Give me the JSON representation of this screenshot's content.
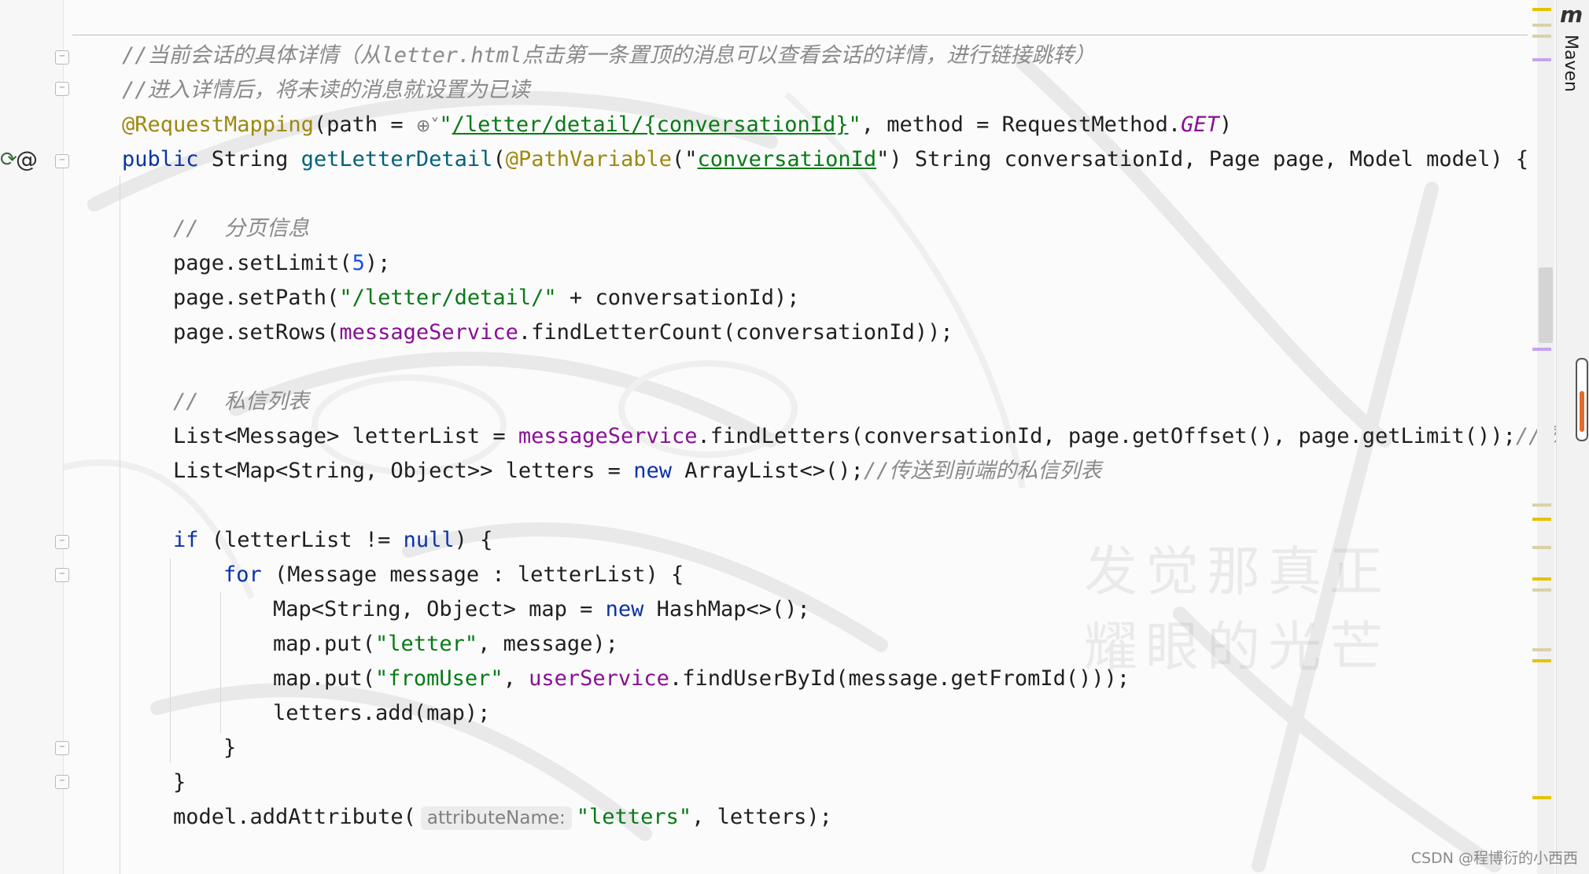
{
  "code": {
    "line1_comment": "//当前会话的具体详情（从letter.html点击第一条置顶的消息可以查看会话的详情，进行链接跳转）",
    "line2_comment": "//进入详情后，将未读的消息就设置为已读",
    "line3": {
      "annotation": "@RequestMapping",
      "open": "(path = ",
      "quote_open": "\"",
      "path": "/letter/detail/{conversationId}",
      "quote_close": "\"",
      "middle": ", method = RequestMethod.",
      "method_const": "GET",
      "close": ")"
    },
    "line4": {
      "kw_public": "public",
      "type": " String ",
      "method_name": "getLetterDetail",
      "paren": "(",
      "annotation": "@PathVariable",
      "ann_open": "(\"",
      "ann_value": "conversationId",
      "ann_close": "\")",
      "params": " String conversationId, Page page, Model model) {"
    },
    "line5_comment": "//  分页信息",
    "line6": {
      "pre": "page.setLimit(",
      "num": "5",
      "post": ");"
    },
    "line7": {
      "pre": "page.setPath(",
      "str": "\"/letter/detail/\"",
      "post": " + conversationId);"
    },
    "line8": {
      "pre": "page.setRows(",
      "field": "messageService",
      "post": ".findLetterCount(conversationId));"
    },
    "line9_comment": "//  私信列表",
    "line10": {
      "pre": "List<Message> letterList = ",
      "field": "messageService",
      "post": ".findLetters(conversationId, page.getOffset(), page.getLimit());",
      "comment": "//数据"
    },
    "line11": {
      "pre": "List<Map<String, Object>> letters = ",
      "kw_new": "new",
      "post": " ArrayList<>();",
      "comment": "//传送到前端的私信列表"
    },
    "line12": {
      "kw_if": "if",
      "mid": " (letterList != ",
      "kw_null": "null",
      "post": ") {"
    },
    "line13": {
      "kw_for": "for",
      "post": " (Message message : letterList) {"
    },
    "line14": {
      "pre": "Map<String, Object> map = ",
      "kw_new": "new",
      "post": " HashMap<>();"
    },
    "line15": {
      "pre": "map.put(",
      "str": "\"letter\"",
      "post": ", message);"
    },
    "line16": {
      "pre": "map.put(",
      "str": "\"fromUser\"",
      "mid": ", ",
      "field": "userService",
      "post": ".findUserById(message.getFromId()));"
    },
    "line17": "letters.add(map);",
    "line18": "}",
    "line19": "}",
    "line20": {
      "pre": "model.addAttribute(",
      "hint": "attributeName:",
      "str": "\"letters\"",
      "post": ", letters);"
    }
  },
  "sidebar": {
    "maven_glyph": "m",
    "maven_label": "Maven"
  },
  "watermark": {
    "line1": "发觉那真正",
    "line2": "耀眼的光芒"
  },
  "credit": "CSDN @程博衍的小西西",
  "icons": {
    "globe": "globe-icon",
    "gutter": "implemented-icon"
  },
  "colors": {
    "keyword": "#0b33a8",
    "string": "#077a16",
    "comment": "#8a8a8a",
    "annotation": "#9e880d",
    "field": "#871094",
    "number": "#1750eb"
  }
}
